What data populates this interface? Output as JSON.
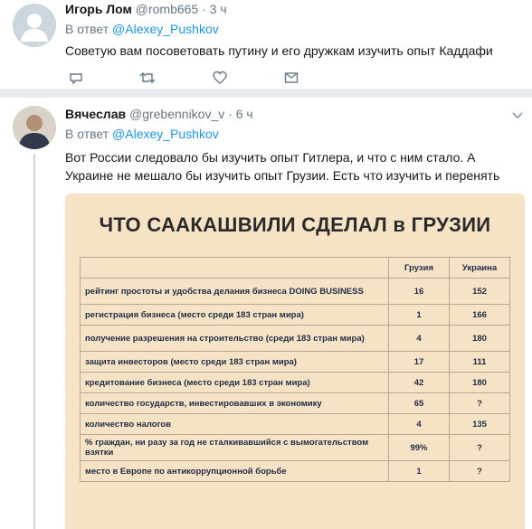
{
  "tweet1": {
    "name": "Игорь Лом",
    "handle": "@romb665",
    "sep": "·",
    "time": "3 ч",
    "reply_prefix": "В ответ",
    "reply_to": "@Alexey_Pushkov",
    "text": "Советую вам посоветовать путину и его дружкам изучить опыт Каддафи",
    "actions": {
      "reply_icon": "reply-icon",
      "retweet_icon": "retweet-icon",
      "like_icon": "heart-icon",
      "dm_icon": "mail-icon"
    }
  },
  "tweet2": {
    "name": "Вячеслав",
    "handle": "@grebennikov_v",
    "sep": "·",
    "time": "6 ч",
    "reply_prefix": "В ответ",
    "reply_to": "@Alexey_Pushkov",
    "text": "Вот России следовало бы изучить опыт  Гитлера, и что с ним стало. А Украине не мешало бы изучить опыт Грузии. Есть  что изучить и перенять"
  },
  "media": {
    "title": "ЧТО СААКАШВИЛИ СДЕЛАЛ в ГРУЗИИ",
    "col_georgia": "Грузия",
    "col_ukraine": "Украина",
    "rows": [
      {
        "label": "рейтинг простоты и удобства делания бизнеса DOING BUSINESS",
        "georgia": "16",
        "ukraine": "152"
      },
      {
        "label": "регистрация бизнеса (место среди 183 стран мира)",
        "georgia": "1",
        "ukraine": "166"
      },
      {
        "label": "получение разрешения на строительство (среди 183 стран мира)",
        "georgia": "4",
        "ukraine": "180"
      },
      {
        "label": "защита инвесторов (место среди 183 стран мира)",
        "georgia": "17",
        "ukraine": "111"
      },
      {
        "label": "кредитование бизнеса (место среди 183 стран мира)",
        "georgia": "42",
        "ukraine": "180"
      },
      {
        "label": "количество государств, инвестировавших в экономику",
        "georgia": "65",
        "ukraine": "?"
      },
      {
        "label": "количество налогов",
        "georgia": "4",
        "ukraine": "135"
      },
      {
        "label": "% граждан, ни разу за год не сталкивавшийся с вымогательством взятки",
        "georgia": "99%",
        "ukraine": "?"
      },
      {
        "label": "место в Европе по антикоррупционной борьбе",
        "georgia": "1",
        "ukraine": "?"
      }
    ]
  },
  "colors": {
    "link": "#1b95e0",
    "muted": "#657786",
    "separator": "#e6ecf0"
  }
}
